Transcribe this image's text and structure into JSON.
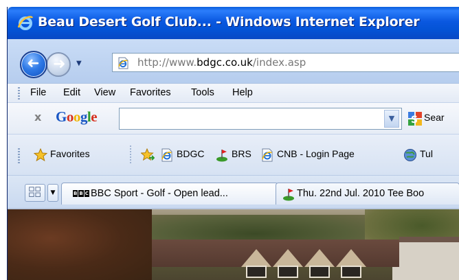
{
  "window": {
    "title": "Beau Desert Golf Club... - Windows Internet Explorer"
  },
  "address_bar": {
    "prefix": "http://www.",
    "host": "bdgc.co.uk",
    "path": "/index.asp"
  },
  "menu": {
    "items": [
      "File",
      "Edit",
      "View",
      "Favorites",
      "Tools",
      "Help"
    ]
  },
  "google_toolbar": {
    "close": "x",
    "logo_letters": [
      "G",
      "o",
      "o",
      "g",
      "l",
      "e"
    ],
    "logo_colors": [
      "#1a57c4",
      "#d6301e",
      "#f0b400",
      "#1a57c4",
      "#2e9b2e",
      "#d6301e"
    ],
    "search_value": "",
    "search_label": "Sear"
  },
  "favorites_bar": {
    "favorites_label": "Favorites",
    "links": [
      {
        "label": "BDGC",
        "icon": "ie-page-icon"
      },
      {
        "label": "BRS",
        "icon": "golf-flag-icon"
      },
      {
        "label": "CNB - Login Page",
        "icon": "ie-page-icon"
      },
      {
        "label": "Tul",
        "icon": "globe-icon"
      }
    ]
  },
  "tabs": [
    {
      "label": "BBC Sport - Golf - Open lead...",
      "icon": "bbc-icon",
      "badge": [
        "B",
        "B",
        "C"
      ]
    },
    {
      "label": "Thu. 22nd Jul. 2010 Tee Boo",
      "icon": "golf-flag-icon"
    }
  ],
  "colors": {
    "titlebar": "#0a58e0",
    "title_text": "#ffffff"
  }
}
